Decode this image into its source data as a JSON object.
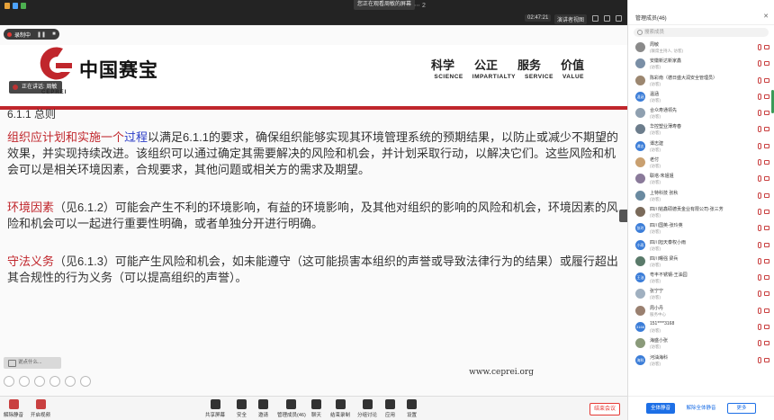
{
  "topbar": {
    "viewing_banner": "您正在观看周敏的屏幕"
  },
  "secondbar": {
    "timer": "02:47:21",
    "view_mode": "演讲者视图"
  },
  "recording": {
    "label": "录制中"
  },
  "slide": {
    "speaker_tag": "正在讲话: 周敏",
    "logo_text": "中国赛宝",
    "logo_sub": "CEPREI",
    "slogan_cn": [
      "科学",
      "公正",
      "服务",
      "价值"
    ],
    "slogan_en": [
      "SCIENCE",
      "IMPARTIALTY",
      "SERVICE",
      "VALUE"
    ],
    "section_title": "6.1.1 总则",
    "para1_red": "组织应计划和实施一个",
    "para1_blue": "过程",
    "para1_rest": "以满足6.1.1的要求，确保组织能够实现其环境管理系统的预期结果，以防止或减少不期望的效果，并实现持续改进。该组织可以通过确定其需要解决的风险和机会，并计划采取行动，以解决它们。这些风险和机会可以是相关环境因素，合规要求，其他问题或相关方的需求及期望。",
    "para2_red": "环境因素",
    "para2_rest": "（见6.1.2）可能会产生不利的环境影响，有益的环境影响，及其他对组织的影响的风险和机会，环境因素的风险和机会可以一起进行重要性明确，或者单独分开进行明确。",
    "para3_red": "守法义务",
    "para3_rest": "（见6.1.3）可能产生风险和机会，如未能遵守（这可能损害本组织的声誉或导致法律行为的结果）或履行超出其合规性的行为义务（可以提高组织的声誉）。",
    "website": "www.ceprei.org",
    "chat_placeholder": "说点什么..."
  },
  "toolbar": {
    "unmute": "解除静音",
    "video": "开启视频",
    "share": "共享屏幕",
    "security": "安全",
    "invite": "邀请",
    "members": "管理成员(46)",
    "chat": "聊天",
    "stop_record": "结束录制",
    "breakout": "分组讨论",
    "apps": "应用",
    "settings": "设置",
    "end": "结束会议"
  },
  "panel": {
    "title": "管理成员(46)",
    "search_placeholder": "搜索成员",
    "participants": [
      {
        "name": "周敏",
        "role": "(联席主持人, 访客)",
        "color": "#8a8a8a",
        "avatar": ""
      },
      {
        "name": "安徽新达新家鑫",
        "role": "(访客)",
        "color": "#7a8fa6",
        "avatar": ""
      },
      {
        "name": "陈彩南（德日盛大润安全管理员）",
        "role": "(访客)",
        "color": "#9c8770",
        "avatar": ""
      },
      {
        "name": "温涵",
        "role": "(访客)",
        "color": "#3b7dd8",
        "avatar": "温涵"
      },
      {
        "name": "合众寿通领先",
        "role": "(访客)",
        "color": "#8fa0b0",
        "avatar": ""
      },
      {
        "name": "华控塑业薄寿春",
        "role": "(访客)",
        "color": "#6c7d8c",
        "avatar": ""
      },
      {
        "name": "谭志建",
        "role": "(访客)",
        "color": "#3b7dd8",
        "avatar": "谭志"
      },
      {
        "name": "老付",
        "role": "(访客)",
        "color": "#c9a070",
        "avatar": ""
      },
      {
        "name": "联塔-朱姐姐",
        "role": "(访客)",
        "color": "#8a7a9a",
        "avatar": ""
      },
      {
        "name": "上特科技 张秋",
        "role": "(访客)",
        "color": "#6a8aa0",
        "avatar": ""
      },
      {
        "name": "四川铭鑫硕德贡金业有限公司-张三芳",
        "role": "(访客)",
        "color": "#7a6a5a",
        "avatar": ""
      },
      {
        "name": "四川国英-张玲英",
        "role": "(访客)",
        "color": "#3b7dd8",
        "avatar": "张玲"
      },
      {
        "name": "四川旭天泰权小雨",
        "role": "(访客)",
        "color": "#3b7dd8",
        "avatar": "小雨"
      },
      {
        "name": "四川曙强 梁兵",
        "role": "(访客)",
        "color": "#5a7a6a",
        "avatar": ""
      },
      {
        "name": "粤丰不锈钢-王油园",
        "role": "(访客)",
        "color": "#3b7dd8",
        "avatar": "王油"
      },
      {
        "name": "张宁宁",
        "role": "(访客)",
        "color": "#a0b0c0",
        "avatar": ""
      },
      {
        "name": "周小丹",
        "role": "服务中心",
        "color": "#9a8070",
        "avatar": ""
      },
      {
        "name": "151****3168",
        "role": "(访客)",
        "color": "#3b7dd8",
        "avatar": "3168"
      },
      {
        "name": "海盛小张",
        "role": "(访客)",
        "color": "#8a9a7a",
        "avatar": ""
      },
      {
        "name": "河油海科",
        "role": "(访客)",
        "color": "#3b7dd8",
        "avatar": "海科"
      }
    ],
    "mute_all": "全体静音",
    "unmute_all": "解除全体静音",
    "more": "更多"
  }
}
